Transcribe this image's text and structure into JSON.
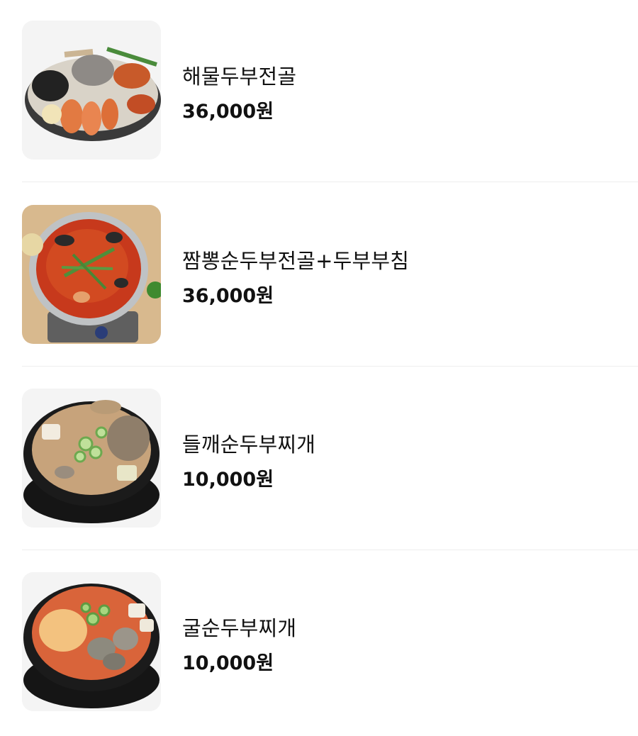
{
  "menu": {
    "items": [
      {
        "name": "해물두부전골",
        "price": "36,000원",
        "photo": "seafood-tofu-hotpot"
      },
      {
        "name": "짬뽕순두부전골+두부부침",
        "price": "36,000원",
        "photo": "jjamppong-soft-tofu-hotpot"
      },
      {
        "name": "들깨순두부찌개",
        "price": "10,000원",
        "photo": "perilla-soft-tofu-stew"
      },
      {
        "name": "굴순두부찌개",
        "price": "10,000원",
        "photo": "oyster-soft-tofu-stew"
      }
    ]
  },
  "colors": {
    "text": "#111111",
    "divider": "#eeeeee",
    "thumb_bg": "#f5f5f5"
  }
}
